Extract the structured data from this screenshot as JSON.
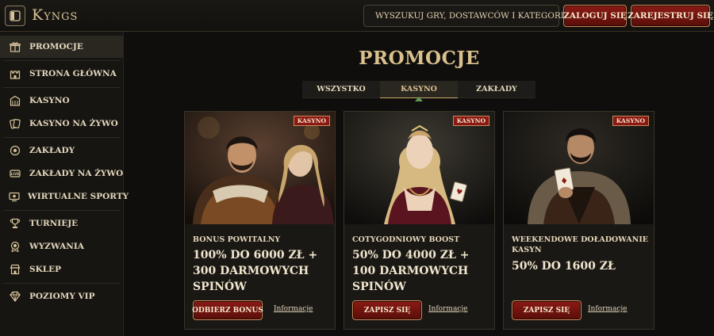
{
  "header": {
    "logo": "Kyngs",
    "search_placeholder": "WYSZUKUJ GRY, DOSTAWCÓW I KATEGORIE",
    "login_label": "ZALOGUJ SIĘ",
    "register_label": "ZAREJESTRUJ SIĘ"
  },
  "sidebar": {
    "items": [
      {
        "label": "PROMOCJE",
        "icon": "gift-icon"
      },
      {
        "label": "STRONA GŁÓWNA",
        "icon": "castle-icon"
      },
      {
        "label": "KASYNO",
        "icon": "casino-icon"
      },
      {
        "label": "KASYNO NA ŻYWO",
        "icon": "cards-icon"
      },
      {
        "label": "ZAKŁADY",
        "icon": "ball-icon"
      },
      {
        "label": "ZAKŁADY NA ŻYWO",
        "icon": "live-icon"
      },
      {
        "label": "WIRTUALNE SPORTY",
        "icon": "monitor-icon"
      },
      {
        "label": "TURNIEJE",
        "icon": "trophy-icon"
      },
      {
        "label": "WYZWANIA",
        "icon": "challenge-icon"
      },
      {
        "label": "SKLEP",
        "icon": "shop-icon"
      },
      {
        "label": "POZIOMY VIP",
        "icon": "diamond-icon"
      }
    ]
  },
  "main": {
    "title": "PROMOCJE",
    "tabs": [
      {
        "label": "WSZYSTKO",
        "active": false
      },
      {
        "label": "KASYNO",
        "active": true
      },
      {
        "label": "ZAKŁADY",
        "active": false
      }
    ],
    "cards": [
      {
        "badge": "KASYNO",
        "subtitle": "BONUS POWITALNY",
        "offer": "100% DO 6000 ZŁ + 300 DARMOWYCH SPINÓW",
        "button": "ODBIERZ BONUS",
        "link": "Informacje"
      },
      {
        "badge": "KASYNO",
        "subtitle": "COTYGODNIOWY BOOST",
        "offer": "50% DO 4000 ZŁ + 100 DARMOWYCH SPINÓW",
        "button": "ZAPISZ SIĘ",
        "link": "Informacje"
      },
      {
        "badge": "KASYNO",
        "subtitle": "WEEKENDOWE DOŁADOWANIE KASYN",
        "offer": "50% DO 1600 ZŁ",
        "button": "ZAPISZ SIĘ",
        "link": "Informacje"
      }
    ]
  },
  "colors": {
    "accent_gold": "#d9c08e",
    "button_red": "#8a1a14",
    "background": "#0f0e0c"
  }
}
